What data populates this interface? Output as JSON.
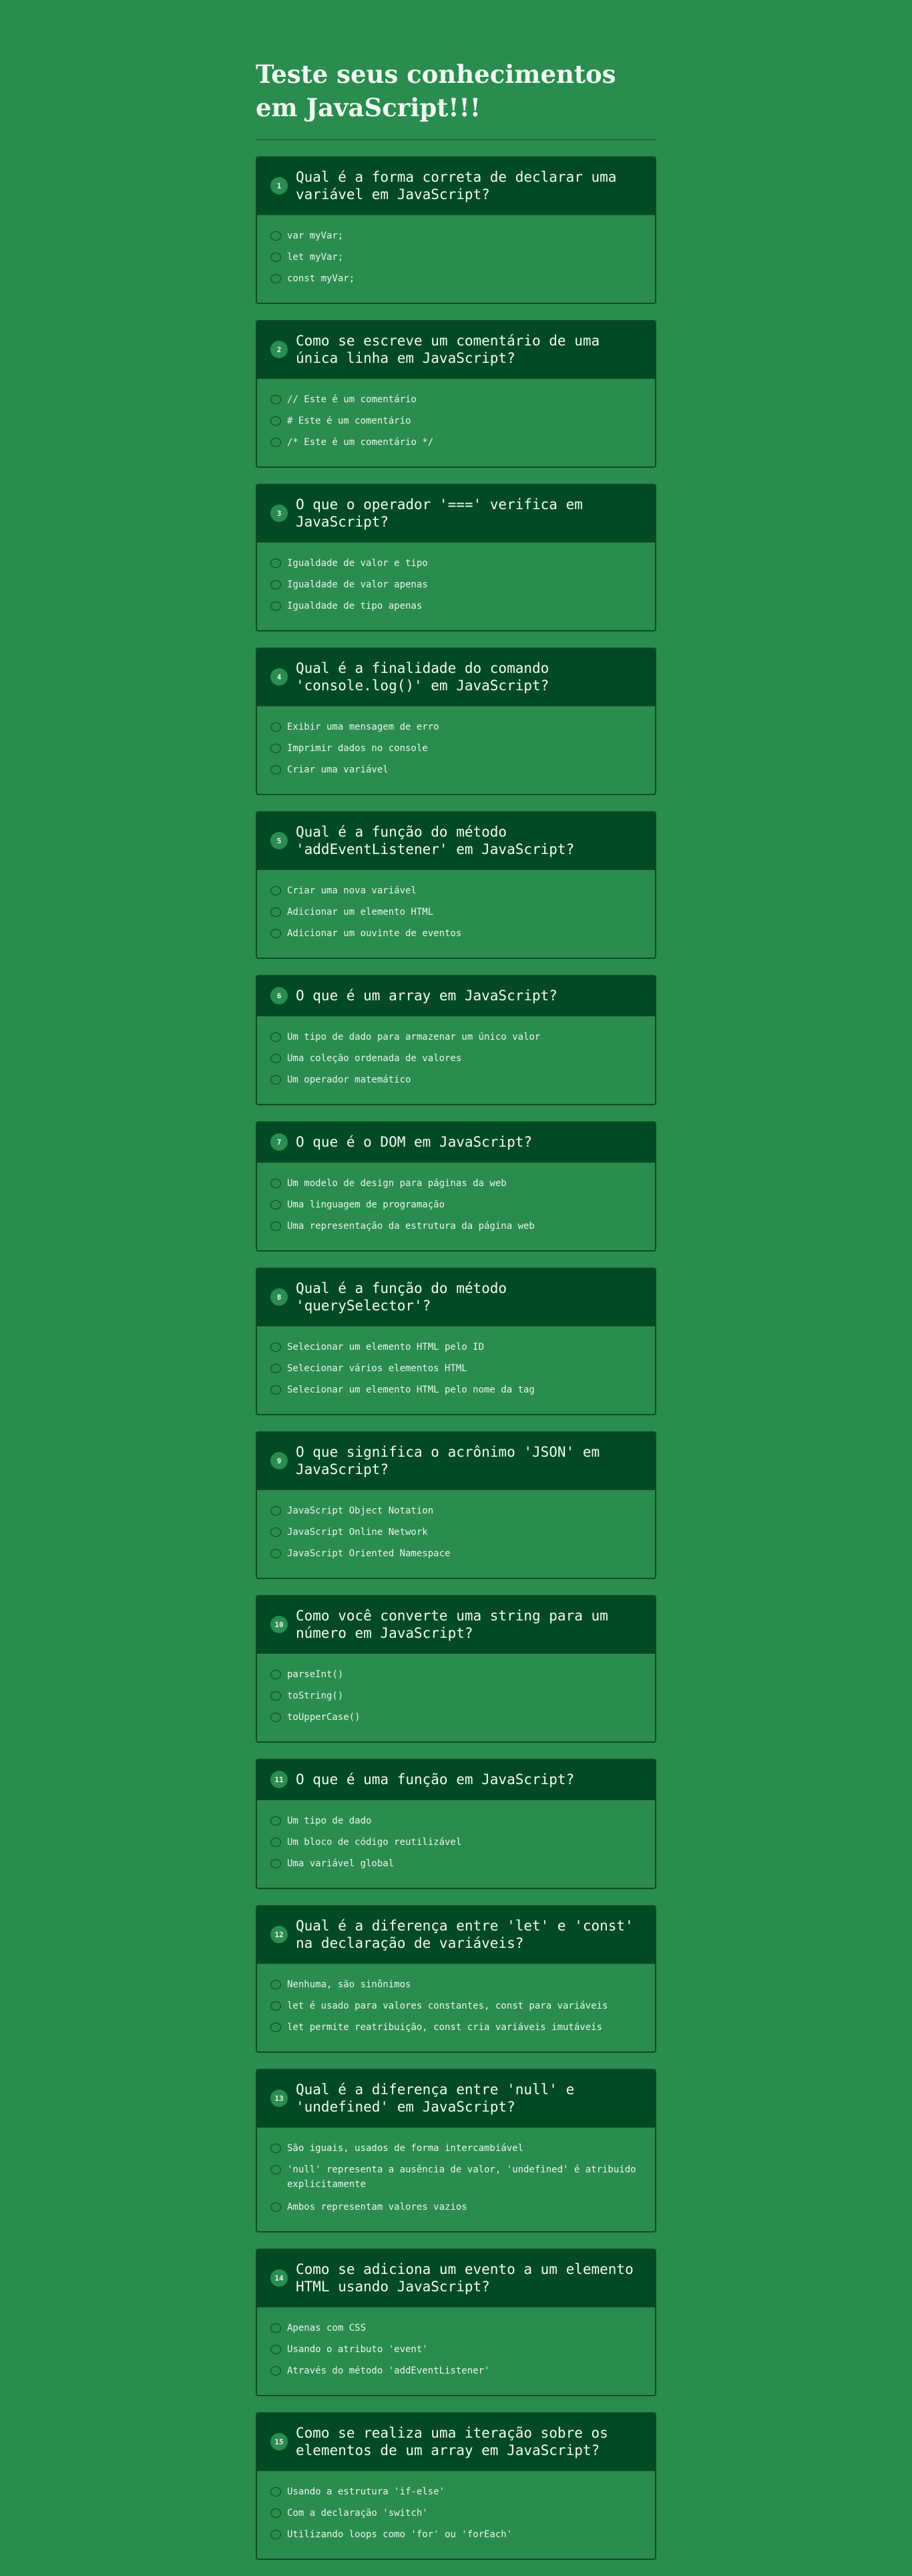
{
  "page": {
    "title": "Teste seus conhecimentos em JavaScript!!!"
  },
  "colors": {
    "background": "#2a8c4e",
    "header": "#024a24",
    "border": "#0e4a26"
  },
  "questions": [
    {
      "number": "1",
      "text": "Qual é a forma correta de declarar uma variável em JavaScript?",
      "options": [
        "var myVar;",
        "let myVar;",
        "const myVar;"
      ]
    },
    {
      "number": "2",
      "text": "Como se escreve um comentário de uma única linha em JavaScript?",
      "options": [
        "// Este é um comentário",
        "# Este é um comentário",
        "/* Este é um comentário */"
      ]
    },
    {
      "number": "3",
      "text": "O que o operador '===' verifica em JavaScript?",
      "options": [
        "Igualdade de valor e tipo",
        "Igualdade de valor apenas",
        "Igualdade de tipo apenas"
      ]
    },
    {
      "number": "4",
      "text": "Qual é a finalidade do comando 'console.log()' em JavaScript?",
      "options": [
        "Exibir uma mensagem de erro",
        "Imprimir dados no console",
        "Criar uma variável"
      ]
    },
    {
      "number": "5",
      "text": "Qual é a função do método 'addEventListener' em JavaScript?",
      "options": [
        "Criar uma nova variável",
        "Adicionar um elemento HTML",
        "Adicionar um ouvinte de eventos"
      ]
    },
    {
      "number": "6",
      "text": "O que é um array em JavaScript?",
      "options": [
        "Um tipo de dado para armazenar um único valor",
        "Uma coleção ordenada de valores",
        "Um operador matemático"
      ]
    },
    {
      "number": "7",
      "text": "O que é o DOM em JavaScript?",
      "options": [
        "Um modelo de design para páginas da web",
        "Uma linguagem de programação",
        "Uma representação da estrutura da página web"
      ]
    },
    {
      "number": "8",
      "text": "Qual é a função do método 'querySelector'?",
      "options": [
        "Selecionar um elemento HTML pelo ID",
        "Selecionar vários elementos HTML",
        "Selecionar um elemento HTML pelo nome da tag"
      ]
    },
    {
      "number": "9",
      "text": "O que significa o acrônimo 'JSON' em JavaScript?",
      "options": [
        "JavaScript Object Notation",
        "JavaScript Online Network",
        "JavaScript Oriented Namespace"
      ]
    },
    {
      "number": "10",
      "text": "Como você converte uma string para um número em JavaScript?",
      "options": [
        "parseInt()",
        "toString()",
        "toUpperCase()"
      ]
    },
    {
      "number": "11",
      "text": "O que é uma função em JavaScript?",
      "options": [
        "Um tipo de dado",
        "Um bloco de código reutilizável",
        "Uma variável global"
      ]
    },
    {
      "number": "12",
      "text": "Qual é a diferença entre 'let' e 'const' na declaração de variáveis?",
      "options": [
        "Nenhuma, são sinônimos",
        "let é usado para valores constantes, const para variáveis",
        "let permite reatribuição, const cria variáveis imutáveis"
      ]
    },
    {
      "number": "13",
      "text": "Qual é a diferença entre 'null' e 'undefined' em JavaScript?",
      "options": [
        "São iguais, usados de forma intercambiável",
        "'null' representa a ausência de valor, 'undefined' é atribuído explicitamente",
        "Ambos representam valores vazios"
      ]
    },
    {
      "number": "14",
      "text": "Como se adiciona um evento a um elemento HTML usando JavaScript?",
      "options": [
        "Apenas com CSS",
        "Usando o atributo 'event'",
        "Através do método 'addEventListener'"
      ]
    },
    {
      "number": "15",
      "text": "Como se realiza uma iteração sobre os elementos de um array em JavaScript?",
      "options": [
        "Usando a estrutura 'if-else'",
        "Com a declaração 'switch'",
        "Utilizando loops como 'for' ou 'forEach'"
      ]
    }
  ]
}
